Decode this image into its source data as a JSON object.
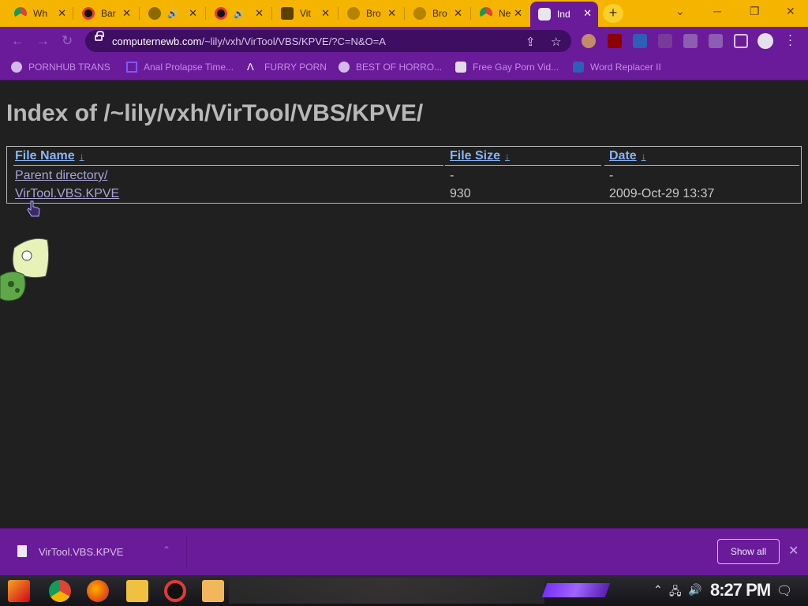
{
  "browser": {
    "tabs": [
      {
        "label": "Wh",
        "icon": "chrome-icon"
      },
      {
        "label": "Bar",
        "icon": "record-icon"
      },
      {
        "label": "",
        "icon": "globe-icon",
        "audio": true
      },
      {
        "label": "",
        "icon": "record-icon",
        "audio": true
      },
      {
        "label": "Vit",
        "icon": "play-icon"
      },
      {
        "label": "Bro",
        "icon": "ufo-icon"
      },
      {
        "label": "Bro",
        "icon": "ufo-icon"
      },
      {
        "label": "Ne",
        "icon": "chrome-icon"
      },
      {
        "label": "Ind",
        "icon": "skull-icon",
        "active": true
      }
    ],
    "url_domain": "computernewb.com",
    "url_path": "/~lily/vxh/VirTool/VBS/KPVE/?C=N&O=A",
    "bookmarks": [
      {
        "label": "PORNHUB TRANS"
      },
      {
        "label": "Anal Prolapse Time..."
      },
      {
        "label": "FURRY PORN"
      },
      {
        "label": "BEST OF HORRO..."
      },
      {
        "label": "Free Gay Porn Vid..."
      },
      {
        "label": "Word Replacer II"
      }
    ]
  },
  "page": {
    "title": "Index of /~lily/vxh/VirTool/VBS/KPVE/",
    "columns": {
      "name": "File Name",
      "size": "File Size",
      "date": "Date",
      "sort_arrow": "↓"
    },
    "rows": [
      {
        "name": "Parent directory/",
        "size": "-",
        "date": "-"
      },
      {
        "name": "VirTool.VBS.KPVE",
        "size": "930",
        "date": "2009-Oct-29 13:37"
      }
    ]
  },
  "download_bar": {
    "file_name": "VirTool.VBS.KPVE",
    "show_all": "Show all"
  },
  "taskbar": {
    "time": "8:27 PM"
  },
  "colors": {
    "tabstrip": "#f5b400",
    "toolbar": "#6a1b9a",
    "link": "#8ab4f8",
    "page_bg": "#202020"
  }
}
